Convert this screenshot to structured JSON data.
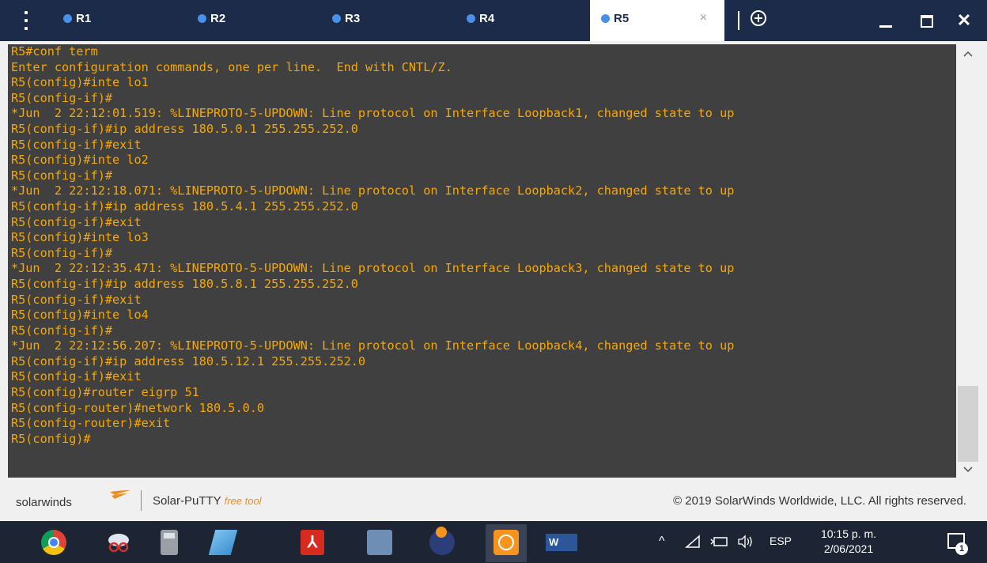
{
  "tabs": [
    {
      "label": "R1",
      "active": false
    },
    {
      "label": "R2",
      "active": false
    },
    {
      "label": "R3",
      "active": false
    },
    {
      "label": "R4",
      "active": false
    },
    {
      "label": "R5",
      "active": true
    }
  ],
  "tab_close_symbol": "×",
  "window": {
    "close_symbol": "✕"
  },
  "terminal_lines": [
    "R5#conf term",
    "Enter configuration commands, one per line.  End with CNTL/Z.",
    "R5(config)#inte lo1",
    "R5(config-if)#",
    "*Jun  2 22:12:01.519: %LINEPROTO-5-UPDOWN: Line protocol on Interface Loopback1, changed state to up",
    "R5(config-if)#ip address 180.5.0.1 255.255.252.0",
    "R5(config-if)#exit",
    "R5(config)#inte lo2",
    "R5(config-if)#",
    "*Jun  2 22:12:18.071: %LINEPROTO-5-UPDOWN: Line protocol on Interface Loopback2, changed state to up",
    "R5(config-if)#ip address 180.5.4.1 255.255.252.0",
    "R5(config-if)#exit",
    "R5(config)#inte lo3",
    "R5(config-if)#",
    "*Jun  2 22:12:35.471: %LINEPROTO-5-UPDOWN: Line protocol on Interface Loopback3, changed state to up",
    "R5(config-if)#ip address 180.5.8.1 255.255.252.0",
    "R5(config-if)#exit",
    "R5(config)#inte lo4",
    "R5(config-if)#",
    "*Jun  2 22:12:56.207: %LINEPROTO-5-UPDOWN: Line protocol on Interface Loopback4, changed state to up",
    "R5(config-if)#ip address 180.5.12.1 255.255.252.0",
    "R5(config-if)#exit",
    "R5(config)#router eigrp 51",
    "R5(config-router)#network 180.5.0.0",
    "R5(config-router)#exit",
    "R5(config)#"
  ],
  "footer": {
    "brand": "solarwinds",
    "product": "Solar-PuTTY",
    "product_tag": "free tool",
    "copyright": "© 2019 SolarWinds Worldwide, LLC. All rights reserved."
  },
  "taskbar": {
    "pdf_glyph": "⅄",
    "word_label": "W",
    "chevron": "^",
    "language": "ESP",
    "time": "10:15 p. m.",
    "date": "2/06/2021",
    "notification_count": "1"
  },
  "colors": {
    "tab_bar": "#1b2b49",
    "tab_dot": "#4a90e8",
    "terminal_bg": "#404040",
    "terminal_text": "#f6a800",
    "taskbar": "#1d2433",
    "brand_accent": "#f28c1c"
  }
}
